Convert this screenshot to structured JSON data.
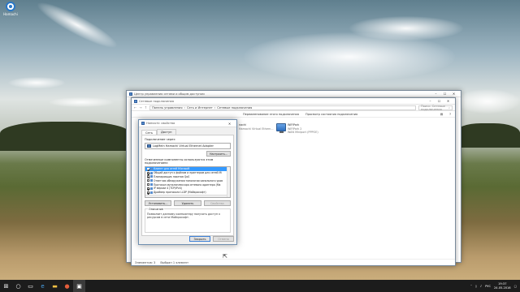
{
  "desktop": {
    "icon_label": "Hamachi"
  },
  "back_window": {
    "title": "Центр управления сетями и общим доступом"
  },
  "main_window": {
    "title": "Сетевые подключения",
    "breadcrumb": [
      "Панель управления",
      "Сеть и Интернет",
      "Сетевые подключения"
    ],
    "search_placeholder": "Поиск: Сетевые подключения",
    "commands": [
      "Переименование этого подключения",
      "Просмотр состояния подключения"
    ],
    "adapter_left": {
      "line1": "nachi",
      "line2": "Hamachi Virtual Ethern..."
    },
    "adapter_right": {
      "name": "WiFiPark",
      "network": "WiFiPark 2",
      "device": "WAN Miniport (PPPOE)"
    },
    "status_items": "Элементов: 3",
    "status_selected": "Выбран 1 элемент"
  },
  "dialog": {
    "title": "Hamachi: свойства",
    "tabs": [
      "Сеть",
      "Доступ"
    ],
    "connect_via_label": "Подключение через:",
    "adapter_name": "LogMeIn Hamachi Virtual Ethernet Adapter",
    "configure_button": "Настроить...",
    "components_label": "Отмеченные компоненты используются этим подключением:",
    "components": [
      {
        "label": "Клиент для сетей Microsoft",
        "checked": true,
        "selected": true
      },
      {
        "label": "Общий доступ к файлам и принтерам для сетей Mi",
        "checked": true,
        "selected": false
      },
      {
        "label": "Планировщик пакетов QoS",
        "checked": true,
        "selected": false
      },
      {
        "label": "Ответчик обнаружения топологии канального уров",
        "checked": false,
        "selected": false
      },
      {
        "label": "Протокол мультиплексора сетевого адаптера (Ма",
        "checked": false,
        "selected": false
      },
      {
        "label": "IP версии 4 (TCP/IPv4)",
        "checked": true,
        "selected": false
      },
      {
        "label": "Драйвер протокола LLDP (Майкрософт)",
        "checked": true,
        "selected": false
      }
    ],
    "install_button": "Установить...",
    "uninstall_button": "Удалить",
    "properties_button": "Свойства",
    "description_legend": "Описание",
    "description_text": "Позволяет данному компьютеру получать доступ к ресурсам в сети Майкрософт.",
    "close_button": "Закрыть",
    "cancel_button": "Отмена"
  },
  "taskbar": {
    "language": "РУС",
    "time": "19:37",
    "date": "24.05.2016"
  }
}
